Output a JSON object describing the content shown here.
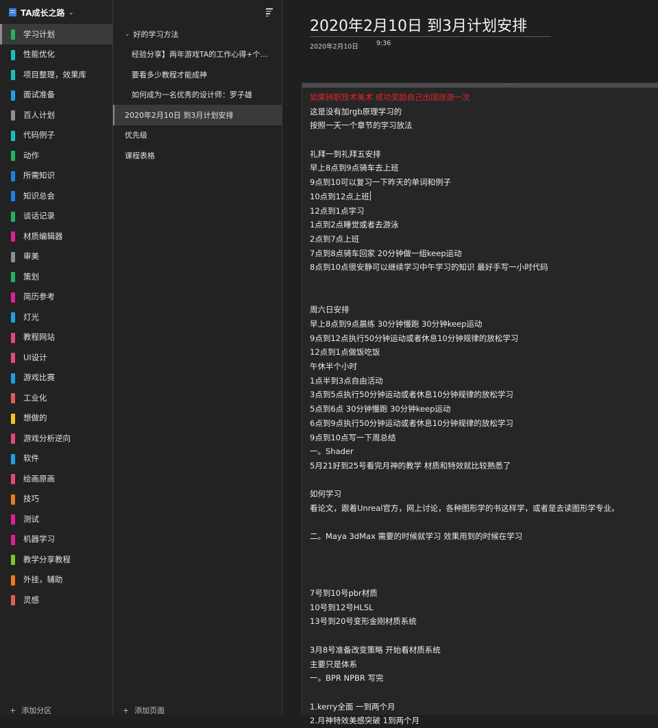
{
  "notebook": {
    "title": "TA成长之路",
    "icon": "notebook-icon"
  },
  "colors": {
    "background": "#1f1f1f",
    "panel": "#222222",
    "selected": "#3a3a3a",
    "red_text": "#e3242b"
  },
  "sections": [
    {
      "label": "学习计划",
      "color": "#1db35b",
      "selected": true
    },
    {
      "label": "性能优化",
      "color": "#17c2b4"
    },
    {
      "label": "项目整理，效果库",
      "color": "#17c2b4"
    },
    {
      "label": "面试准备",
      "color": "#1aa0e8"
    },
    {
      "label": "百人计划",
      "color": "#8a8f96"
    },
    {
      "label": "代码例子",
      "color": "#17c2b4"
    },
    {
      "label": "动作",
      "color": "#1db35b"
    },
    {
      "label": "所需知识",
      "color": "#1a7fe8"
    },
    {
      "label": "知识总会",
      "color": "#1a7fe8"
    },
    {
      "label": "谈话记录",
      "color": "#1db35b"
    },
    {
      "label": "材质编辑器",
      "color": "#e31c9b"
    },
    {
      "label": "审美",
      "color": "#8a8f96"
    },
    {
      "label": "策划",
      "color": "#1db35b"
    },
    {
      "label": "简历参考",
      "color": "#e31c9b"
    },
    {
      "label": "灯光",
      "color": "#1aa0e8"
    },
    {
      "label": "教程网站",
      "color": "#e3487a"
    },
    {
      "label": "UI设计",
      "color": "#e3487a"
    },
    {
      "label": "游戏比赛",
      "color": "#1aa0e8"
    },
    {
      "label": "工业化",
      "color": "#e35a5a"
    },
    {
      "label": "想做的",
      "color": "#f5c518"
    },
    {
      "label": "游戏分析逆向",
      "color": "#e3487a"
    },
    {
      "label": "软件",
      "color": "#1aa0e8"
    },
    {
      "label": "绘画原画",
      "color": "#e3487a"
    },
    {
      "label": "技巧",
      "color": "#f07a1a"
    },
    {
      "label": "测试",
      "color": "#e31c9b"
    },
    {
      "label": "机器学习",
      "color": "#e31c9b"
    },
    {
      "label": "教学分享教程",
      "color": "#7bc91e"
    },
    {
      "label": "外挂，辅助",
      "color": "#f07a1a"
    },
    {
      "label": "灵感",
      "color": "#e35a5a"
    }
  ],
  "add_section_label": "添加分区",
  "pages": [
    {
      "label": "好的学习方法",
      "level": 0,
      "expanded": true
    },
    {
      "label": "经验分享】两年游戏TA的工作心得+个人...",
      "level": 1
    },
    {
      "label": "要看多少教程才能成神",
      "level": 1
    },
    {
      "label": "如何成为一名优秀的设计师：罗子雄",
      "level": 1
    },
    {
      "label": "2020年2月10日 到3月计划安排",
      "level": 0,
      "selected": true
    },
    {
      "label": "优先级",
      "level": 0
    },
    {
      "label": "课程表格",
      "level": 0
    }
  ],
  "add_page_label": "添加页面",
  "page": {
    "title": "2020年2月10日 到3月计划安排",
    "date": "2020年2月10日",
    "time": "9:36"
  },
  "note_lines": [
    {
      "text": "如果转职技术美术 成功奖励自己出国旅游一次",
      "red": true
    },
    {
      "text": "这是没有加rgb原理学习的"
    },
    {
      "text": "按照一天一个章节的学习放法"
    },
    {
      "text": ""
    },
    {
      "text": "礼拜一到礼拜五安排"
    },
    {
      "text": "早上8点到9点骑车去上班"
    },
    {
      "text": "9点到10可以复习一下昨天的单词和例子"
    },
    {
      "text": "10点到12点上班",
      "caret": true
    },
    {
      "text": "12点到1点学习"
    },
    {
      "text": "1点到2点睡觉或者去游泳"
    },
    {
      "text": "2点到7点上班"
    },
    {
      "text": "7点到8点骑车回家 20分钟做一组keep运动"
    },
    {
      "text": "8点到10点很安静可以继续学习中午学习的知识 最好手写一小时代码"
    },
    {
      "text": ""
    },
    {
      "text": ""
    },
    {
      "text": "周六日安排"
    },
    {
      "text": "早上8点到9点晨练 30分钟慢跑 30分钟keep运动"
    },
    {
      "text": "9点到12点执行50分钟运动或者休息10分钟规律的放松学习"
    },
    {
      "text": "12点到1点做饭吃饭"
    },
    {
      "text": "午休半个小时"
    },
    {
      "text": "1点半到3点自由活动"
    },
    {
      "text": "3点到5点执行50分钟运动或者休息10分钟规律的放松学习"
    },
    {
      "text": "5点到6点 30分钟慢跑 30分钟keep运动"
    },
    {
      "text": "6点到9点执行50分钟运动或者休息10分钟规律的放松学习"
    },
    {
      "text": "9点到10点写一下周总结"
    },
    {
      "text": "一。Shader"
    },
    {
      "text": "5月21好到25号看完月神的教学 材质和特效就比较熟悉了"
    },
    {
      "text": ""
    },
    {
      "text": "如何学习"
    },
    {
      "text": "看论文，跟着Unreal官方，网上讨论，各种图形学的书这样学，或者是去读图形学专业。"
    },
    {
      "text": ""
    },
    {
      "text": "二。Maya 3dMax 需要的时候就学习 效果用到的时候在学习"
    },
    {
      "text": ""
    },
    {
      "text": ""
    },
    {
      "text": ""
    },
    {
      "text": "7号到10号pbr材质"
    },
    {
      "text": "10号到12号HLSL"
    },
    {
      "text": "13号到20号变形金刚材质系统"
    },
    {
      "text": ""
    },
    {
      "text": "3月8号准备改变策略 开始看材质系统"
    },
    {
      "text": "主要只是体系"
    },
    {
      "text": "一。BPR NPBR 写完"
    },
    {
      "text": ""
    },
    {
      "text": "1.kerry全面  一到两个月"
    },
    {
      "text": "2.月神特效美感突破 1到两个月"
    }
  ],
  "icons": {
    "sort": "sort-icon",
    "chevron": "chevron-down-icon",
    "add": "plus-icon"
  }
}
